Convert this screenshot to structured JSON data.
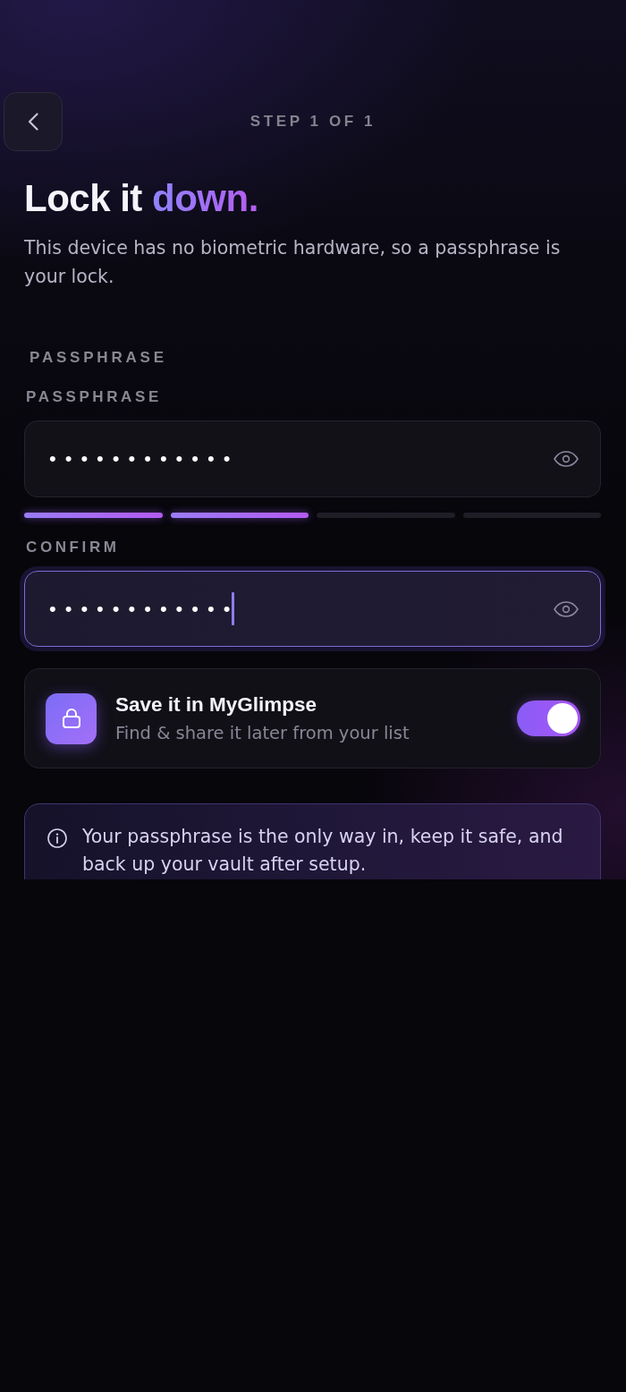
{
  "header": {
    "step": "STEP 1 OF 1"
  },
  "heading": {
    "text": "Lock it",
    "accent": "down."
  },
  "intro": "This device has no biometric hardware, so a passphrase is your lock.",
  "section_label": "PASSPHRASE",
  "fields": [
    {
      "label": "PASSPHRASE",
      "value": "••••••••••••",
      "focused": false,
      "strength_segments": [
        {
          "filled": true
        },
        {
          "filled": true
        },
        {
          "filled": false
        },
        {
          "filled": false
        }
      ]
    },
    {
      "label": "CONFIRM",
      "value": "••••••••••••",
      "focused": true
    }
  ],
  "save_option": {
    "title": "Save it in MyGlimpse",
    "subtitle": "Find & share it later from your list",
    "on": true
  },
  "notice": "Your passphrase is the only way in, keep it safe, and back up your vault after setup."
}
